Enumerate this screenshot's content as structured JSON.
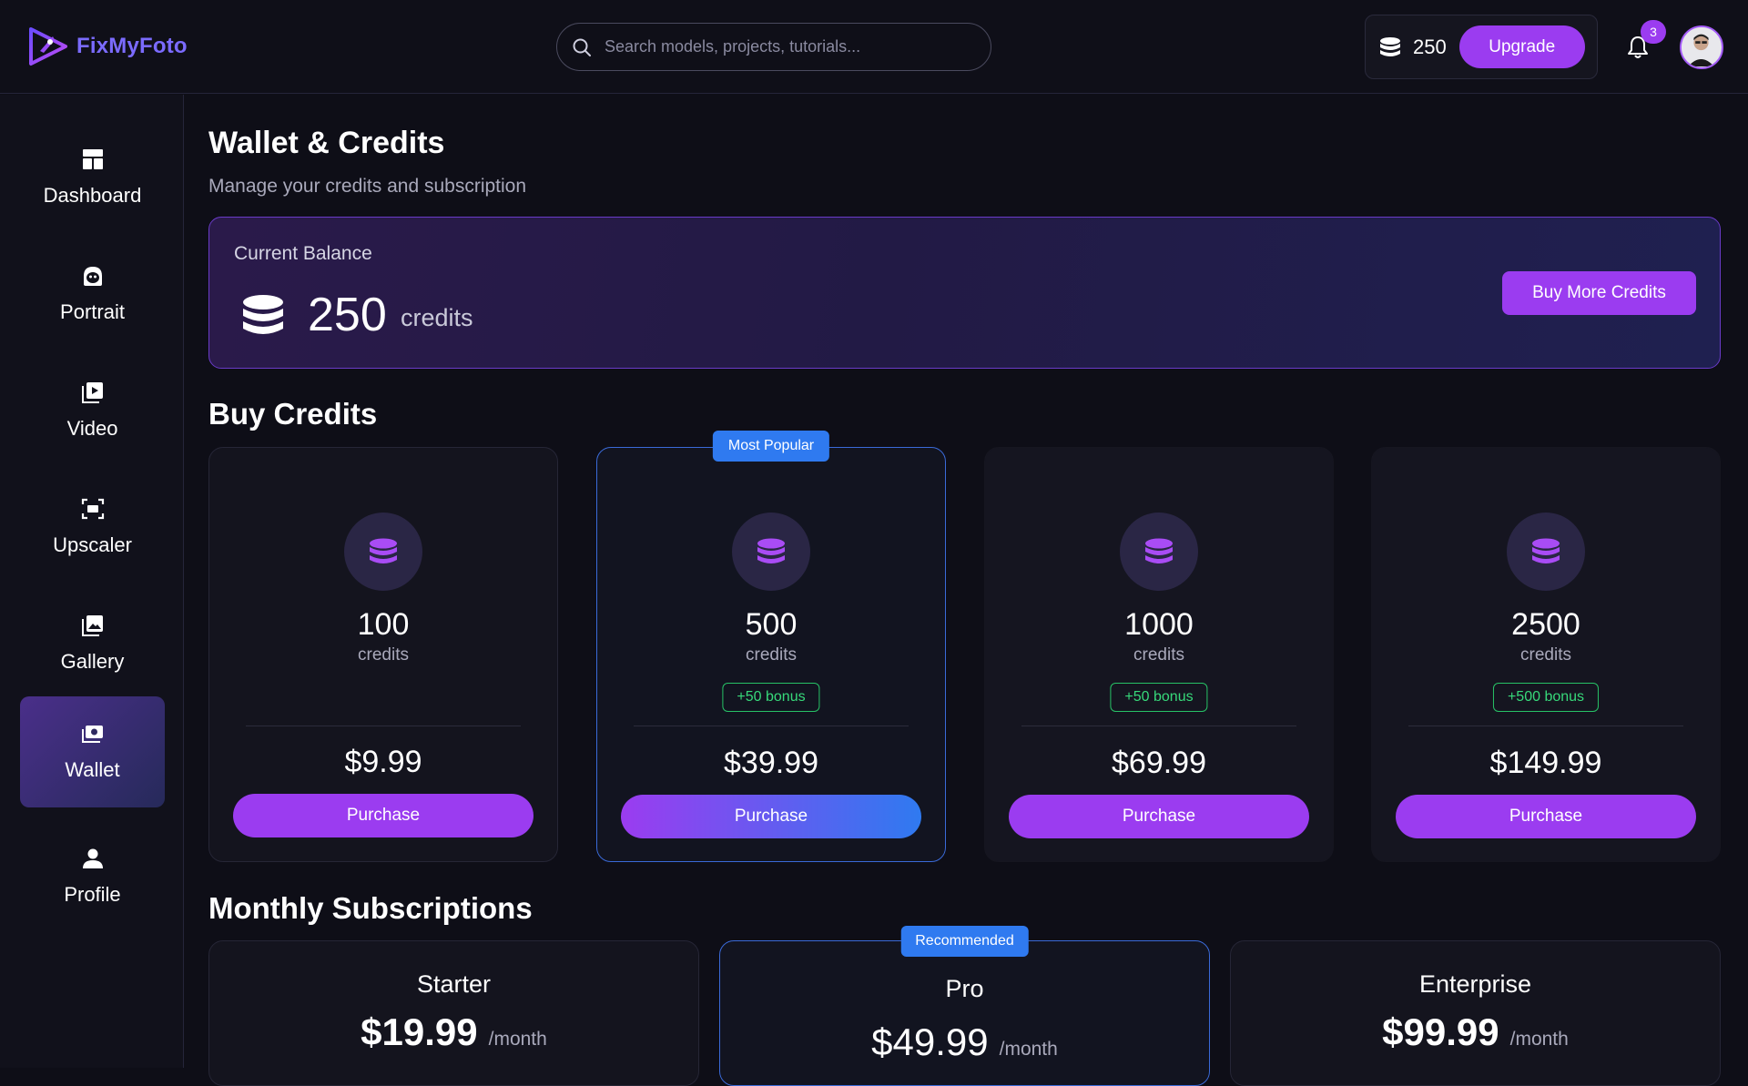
{
  "app": {
    "name": "FixMyFoto"
  },
  "search": {
    "placeholder": "Search models, projects, tutorials..."
  },
  "header": {
    "credits": "250",
    "upgrade_label": "Upgrade",
    "notification_count": "3"
  },
  "sidebar": {
    "items": [
      {
        "label": "Dashboard",
        "icon": "dashboard-icon"
      },
      {
        "label": "Portrait",
        "icon": "portrait-icon"
      },
      {
        "label": "Video",
        "icon": "video-icon"
      },
      {
        "label": "Upscaler",
        "icon": "upscaler-icon"
      },
      {
        "label": "Gallery",
        "icon": "gallery-icon"
      },
      {
        "label": "Wallet",
        "icon": "wallet-icon",
        "active": true
      },
      {
        "label": "Profile",
        "icon": "profile-icon"
      }
    ]
  },
  "page": {
    "title": "Wallet & Credits",
    "subtitle": "Manage your credits and subscription"
  },
  "balance": {
    "label": "Current Balance",
    "amount": "250",
    "unit": "credits",
    "buy_more_label": "Buy More Credits"
  },
  "buy_credits": {
    "title": "Buy Credits",
    "packs": [
      {
        "amount": "100",
        "unit": "credits",
        "bonus": "",
        "price": "$9.99",
        "button": "Purchase",
        "ribbon": ""
      },
      {
        "amount": "500",
        "unit": "credits",
        "bonus": "+50 bonus",
        "price": "$39.99",
        "button": "Purchase",
        "ribbon": "Most Popular"
      },
      {
        "amount": "1000",
        "unit": "credits",
        "bonus": "+50 bonus",
        "price": "$69.99",
        "button": "Purchase",
        "ribbon": ""
      },
      {
        "amount": "2500",
        "unit": "credits",
        "bonus": "+500 bonus",
        "price": "$149.99",
        "button": "Purchase",
        "ribbon": ""
      }
    ]
  },
  "subscriptions": {
    "title": "Monthly Subscriptions",
    "plans": [
      {
        "name": "Starter",
        "price": "$19.99",
        "period": "/month",
        "ribbon": ""
      },
      {
        "name": "Pro",
        "price": "$49.99",
        "period": "/month",
        "ribbon": "Recommended"
      },
      {
        "name": "Enterprise",
        "price": "$99.99",
        "period": "/month",
        "ribbon": ""
      }
    ]
  },
  "colors": {
    "accent": "#9b3cf0",
    "accent_blue": "#2f7af0",
    "bonus_green": "#37d97a",
    "background": "#0e0e17"
  }
}
